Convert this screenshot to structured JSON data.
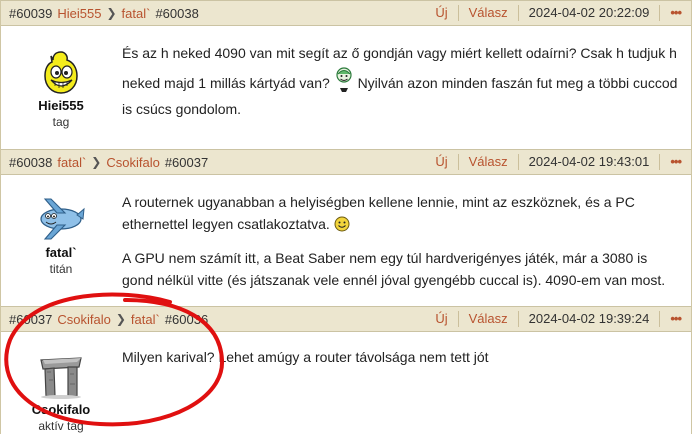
{
  "posts": [
    {
      "num": "#60039",
      "from": "Hiei555",
      "to": "fatal`",
      "reply_to": "#60038",
      "new_label": "Új",
      "reply_label": "Válasz",
      "date": "2024-04-02 20:22:09",
      "more": "•••",
      "author": "Hiei555",
      "rank": "tag",
      "avatar_icon": "yellow-smiley-avatar",
      "text1": "És az h neked 4090 van mit segít az ő gondján vagy miért kellett odaírni? Csak h tudjuk h neked majd 1 millás kártyád van?",
      "text2": "Nyilván azon minden faszán fut meg a többi cuccod is csúcs gondolom."
    },
    {
      "num": "#60038",
      "from": "fatal`",
      "to": "Csokifalo",
      "reply_to": "#60037",
      "new_label": "Új",
      "reply_label": "Válasz",
      "date": "2024-04-02 19:43:01",
      "more": "•••",
      "author": "fatal`",
      "rank": "titán",
      "avatar_icon": "airplane-avatar",
      "text1": "A routernek ugyanabban a helyiségben kellene lennie, mint az eszköznek, és a PC ethernettel legyen csatlakoztatva.",
      "text2": "A GPU nem számít itt, a Beat Saber nem egy túl hardverigényes játék, már a 3080 is gond nélkül vitte (és játszanak vele ennél jóval gyengébb cuccal is). 4090-em van most."
    },
    {
      "num": "#60037",
      "from": "Csokifalo",
      "to": "fatal`",
      "reply_to": "#60036",
      "new_label": "Új",
      "reply_label": "Válasz",
      "date": "2024-04-02 19:39:24",
      "more": "•••",
      "author": "Csokifalo",
      "rank": "aktív tag",
      "avatar_icon": "stone-dolmen-avatar",
      "text1": "Milyen karival? Lehet amúgy a router távolsága nem tett jót"
    }
  ],
  "annotation_color": "#e01010"
}
